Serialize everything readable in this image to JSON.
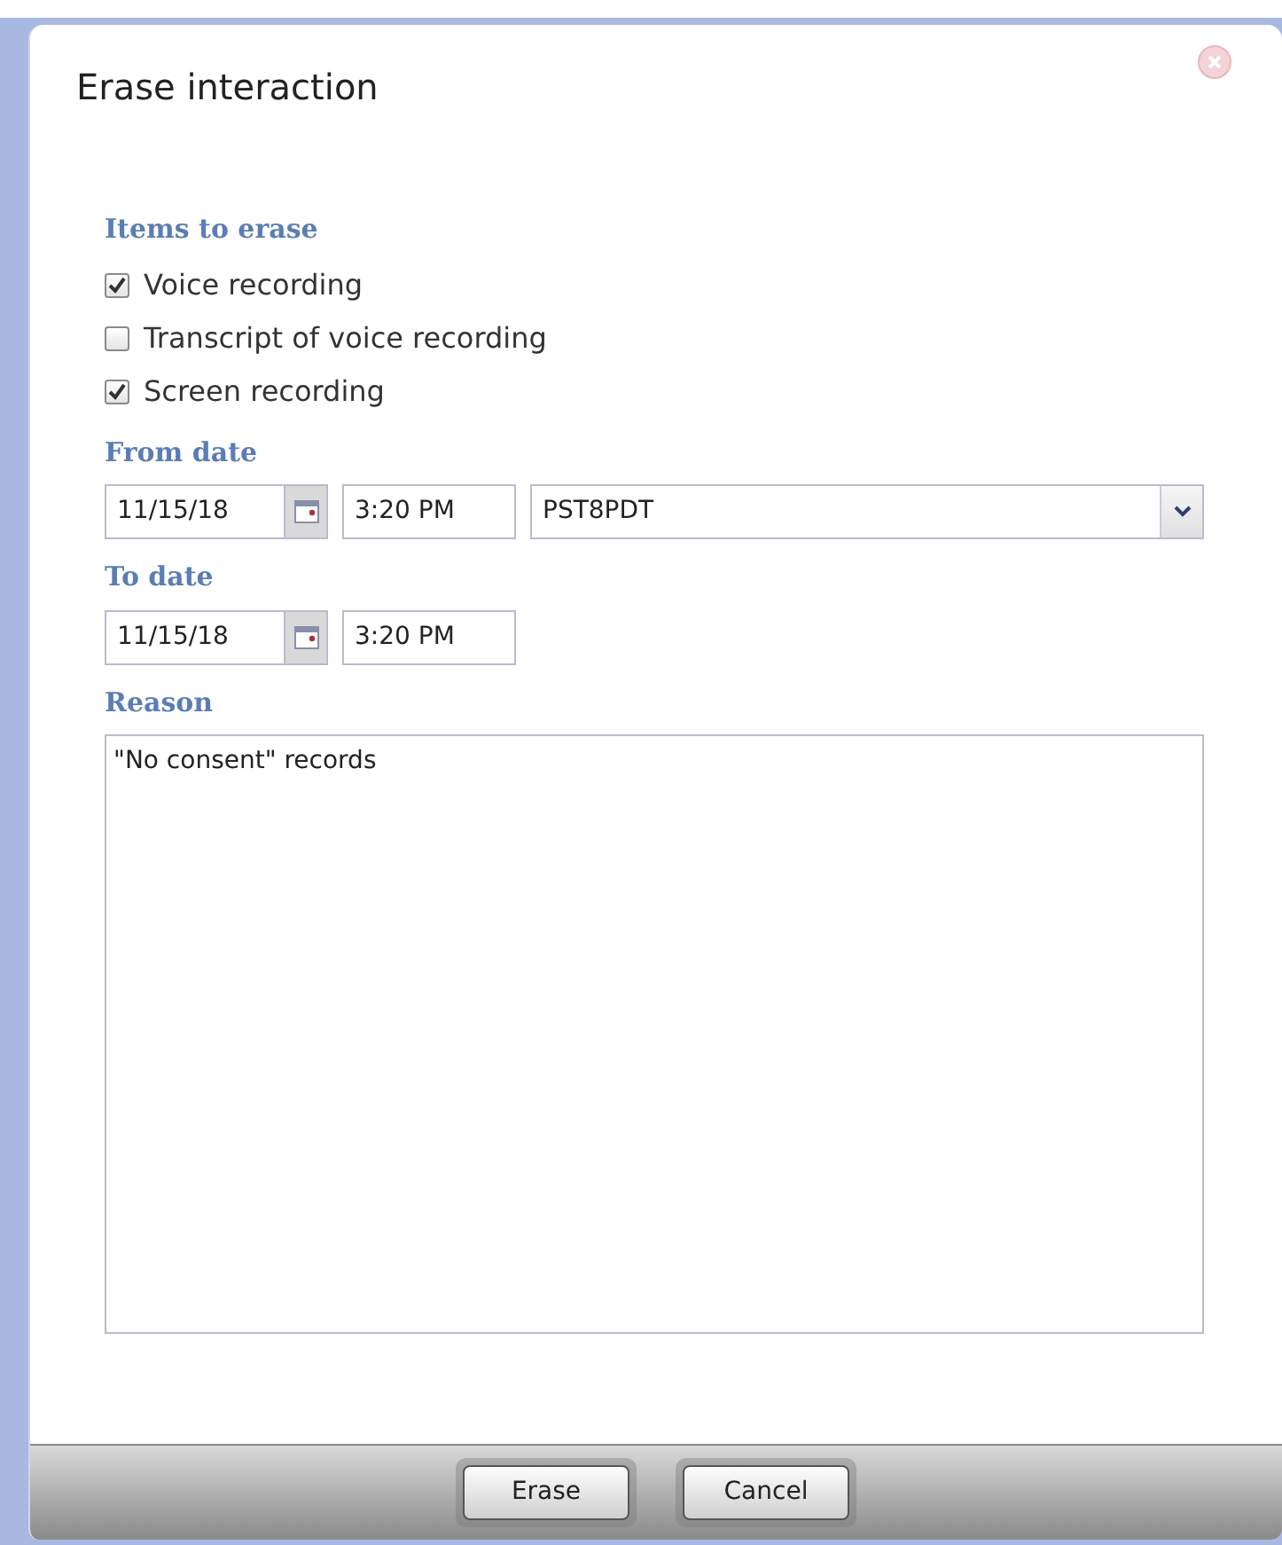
{
  "window": {
    "title": "Erase interaction"
  },
  "items_to_erase": {
    "heading": "Items to erase",
    "options": [
      {
        "label": "Voice recording",
        "checked": true
      },
      {
        "label": "Transcript of voice recording",
        "checked": false
      },
      {
        "label": "Screen recording",
        "checked": true
      }
    ]
  },
  "from_date": {
    "heading": "From date",
    "date": "11/15/18",
    "time": "3:20 PM",
    "timezone": "PST8PDT"
  },
  "to_date": {
    "heading": "To date",
    "date": "11/15/18",
    "time": "3:20 PM"
  },
  "reason": {
    "heading": "Reason",
    "value": "\"No consent\" records"
  },
  "buttons": [
    "Erase",
    "Cancel"
  ]
}
